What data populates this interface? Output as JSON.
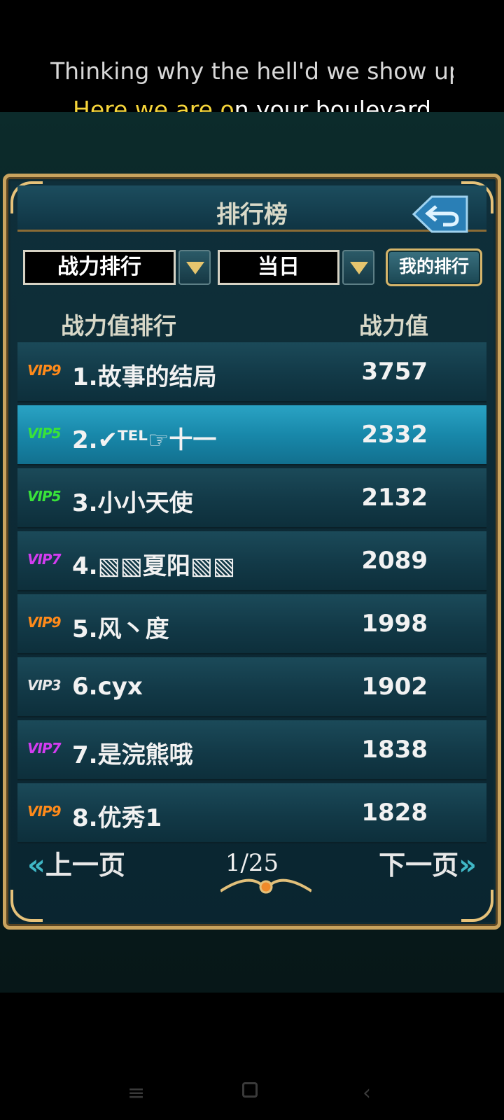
{
  "lyrics": {
    "line1": "Thinking why the hell'd we show up",
    "line2_highlight": "Here we are o",
    "line2_rest": "n your boulevard"
  },
  "panel": {
    "title": "排行榜",
    "back_icon": "back-arrow-icon"
  },
  "filters": {
    "category": "战力排行",
    "period": "当日",
    "my_rank_label": "我的排行"
  },
  "table": {
    "headers": [
      "战力值排行",
      "战力值"
    ],
    "rows": [
      {
        "vip": "VIP9",
        "vip_color": "#ff8a1a",
        "name": "1.故事的结局",
        "power": "3757"
      },
      {
        "vip": "VIP5",
        "vip_color": "#39e23a",
        "name": "2.✔ᵀᴱᴸ☞十一",
        "power": "2332"
      },
      {
        "vip": "VIP5",
        "vip_color": "#39e23a",
        "name": "3.小小天使",
        "power": "2132"
      },
      {
        "vip": "VIP7",
        "vip_color": "#d33cf0",
        "name": "4.▧▧夏阳▧▧",
        "power": "2089"
      },
      {
        "vip": "VIP9",
        "vip_color": "#ff8a1a",
        "name": "5.风丶度",
        "power": "1998"
      },
      {
        "vip": "VIP3",
        "vip_color": "#e8e8e8",
        "name": "6.cyx",
        "power": "1902"
      },
      {
        "vip": "VIP7",
        "vip_color": "#d33cf0",
        "name": "7.是浣熊哦",
        "power": "1838"
      },
      {
        "vip": "VIP9",
        "vip_color": "#ff8a1a",
        "name": "8.优秀1",
        "power": "1828"
      }
    ]
  },
  "pager": {
    "prev_label": "上一页",
    "next_label": "下一页",
    "page": "1/25"
  },
  "navbar": {
    "menu_icon": "menu-icon",
    "home_icon": "home-icon",
    "back_icon": "back-icon"
  }
}
